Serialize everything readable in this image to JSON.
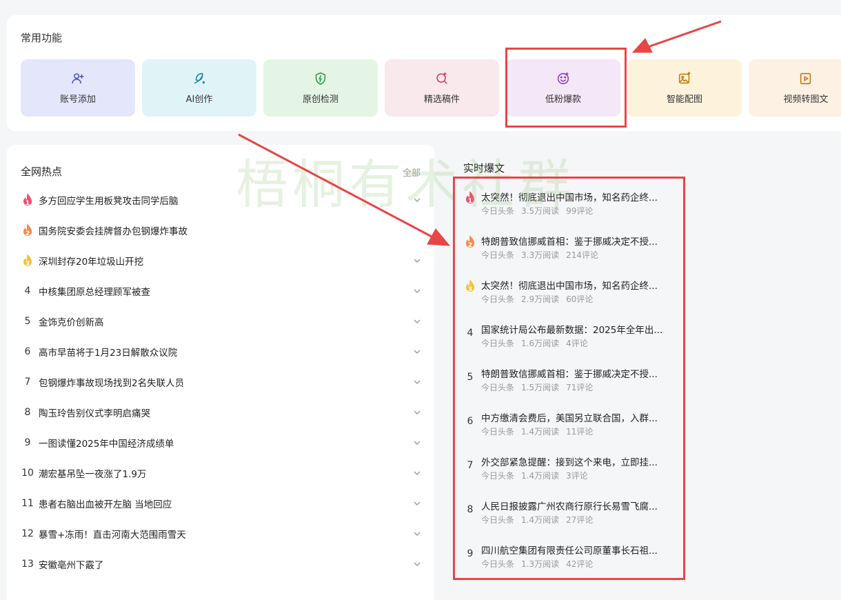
{
  "common": {
    "title": "常用功能",
    "tiles": [
      {
        "label": "账号添加",
        "icon": "add-user-icon",
        "bg": "#e4e6fb",
        "icon_color": "#4a55c8"
      },
      {
        "label": "AI创作",
        "icon": "feather-pen-icon",
        "bg": "#e0f4f8",
        "icon_color": "#1a8aa0"
      },
      {
        "label": "原创检测",
        "icon": "shield-check-icon",
        "bg": "#e4f5e6",
        "icon_color": "#2f9e4a"
      },
      {
        "label": "精选稿件",
        "icon": "search-sparkle-icon",
        "bg": "#f9e8ec",
        "icon_color": "#d23c5c"
      },
      {
        "label": "低粉爆款",
        "icon": "smile-sparkle-icon",
        "bg": "#f3e7f8",
        "icon_color": "#8d3fb5"
      },
      {
        "label": "智能配图",
        "icon": "image-sparkle-icon",
        "bg": "#fdf3dc",
        "icon_color": "#b98110"
      },
      {
        "label": "视频转图文",
        "icon": "video-doc-icon",
        "bg": "#fdf1e4",
        "icon_color": "#c2741a"
      }
    ]
  },
  "hot": {
    "title": "全网热点",
    "all_label": "全部",
    "items": [
      {
        "rank": "1",
        "text": "多方回应学生用板凳攻击同学后脑"
      },
      {
        "rank": "2",
        "text": "国务院安委会挂牌督办包钢爆炸事故"
      },
      {
        "rank": "3",
        "text": "深圳封存20年垃圾山开挖"
      },
      {
        "rank": "4",
        "text": "中核集团原总经理顾军被查"
      },
      {
        "rank": "5",
        "text": "金饰克价创新高"
      },
      {
        "rank": "6",
        "text": "高市早苗将于1月23日解散众议院"
      },
      {
        "rank": "7",
        "text": "包钢爆炸事故现场找到2名失联人员"
      },
      {
        "rank": "8",
        "text": "陶玉玲告别仪式李明启痛哭"
      },
      {
        "rank": "9",
        "text": "一图读懂2025年中国经济成绩单"
      },
      {
        "rank": "10",
        "text": "潮宏基吊坠一夜涨了1.9万"
      },
      {
        "rank": "11",
        "text": "患者右脑出血被开左脑 当地回应"
      },
      {
        "rank": "12",
        "text": "暴雪+冻雨！直击河南大范围雨雪天"
      },
      {
        "rank": "13",
        "text": "安徽亳州下霰了"
      }
    ]
  },
  "viral": {
    "title": "实时爆文",
    "items": [
      {
        "rank": "1",
        "title": "太突然！彻底退出中国市场，知名药企终...",
        "source": "今日头条",
        "reads": "3.5万阅读",
        "comments": "99评论"
      },
      {
        "rank": "2",
        "title": "特朗普致信挪威首相：鉴于挪威决定不授...",
        "source": "今日头条",
        "reads": "3.3万阅读",
        "comments": "214评论"
      },
      {
        "rank": "3",
        "title": "太突然！彻底退出中国市场，知名药企终...",
        "source": "今日头条",
        "reads": "2.9万阅读",
        "comments": "60评论"
      },
      {
        "rank": "4",
        "title": "国家统计局公布最新数据：2025年全年出...",
        "source": "今日头条",
        "reads": "1.6万阅读",
        "comments": "4评论"
      },
      {
        "rank": "5",
        "title": "特朗普致信挪威首相：鉴于挪威决定不授...",
        "source": "今日头条",
        "reads": "1.5万阅读",
        "comments": "71评论"
      },
      {
        "rank": "6",
        "title": "中方缴清会费后，美国另立联合国，入群...",
        "source": "今日头条",
        "reads": "1.4万阅读",
        "comments": "11评论"
      },
      {
        "rank": "7",
        "title": "外交部紧急提醒：接到这个来电，立即挂...",
        "source": "今日头条",
        "reads": "1.4万阅读",
        "comments": "3评论"
      },
      {
        "rank": "8",
        "title": "人民日报披露广州农商行原行长易雪飞腐...",
        "source": "今日头条",
        "reads": "1.4万阅读",
        "comments": "27评论"
      },
      {
        "rank": "9",
        "title": "四川航空集团有限责任公司原董事长石祖...",
        "source": "今日头条",
        "reads": "1.3万阅读",
        "comments": "42评论"
      }
    ]
  },
  "watermark": "梧桐有术社群",
  "colors": {
    "annotation_red": "#e84545",
    "rank1": "#f0506e",
    "rank2": "#f58a4c",
    "rank3": "#f5c23a"
  }
}
